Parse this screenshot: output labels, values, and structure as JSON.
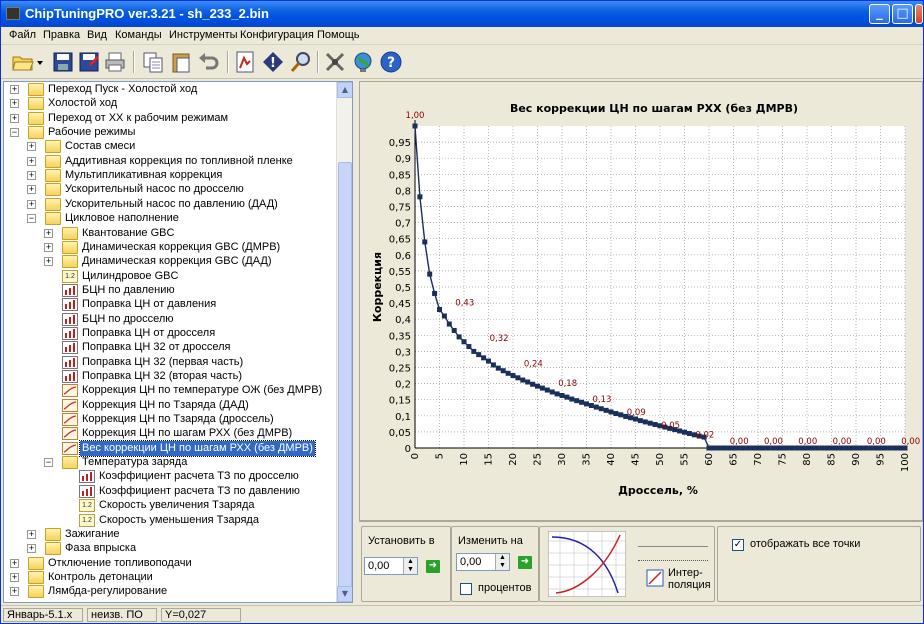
{
  "window": {
    "title": "ChipTuningPRO ver.3.21 - sh_233_2.bin"
  },
  "menu": [
    "Файл",
    "Правка",
    "Вид",
    "Команды",
    "Инструменты",
    "Конфигурация",
    "Помощь"
  ],
  "toolbar": {
    "icons": [
      "open-icon",
      "dropdown-arrow-icon",
      "save-icon",
      "save-as-icon",
      "print-icon",
      "copy-icon",
      "paste-icon",
      "undo-icon",
      "open-map-icon",
      "info-icon",
      "search-icon",
      "tools-icon",
      "globe-icon",
      "help-icon"
    ]
  },
  "tree": {
    "items": [
      {
        "label": "Переход Пуск - Холостой ход",
        "exp": "+",
        "icon": "folder",
        "depth": 0
      },
      {
        "label": "Холостой ход",
        "exp": "+",
        "icon": "folder",
        "depth": 0
      },
      {
        "label": "Переход от ХХ к рабочим режимам",
        "exp": "+",
        "icon": "folder",
        "depth": 0
      },
      {
        "label": "Рабочие режимы",
        "exp": "-",
        "icon": "folder",
        "depth": 0
      },
      {
        "label": "Состав смеси",
        "exp": "+",
        "icon": "folder",
        "depth": 1
      },
      {
        "label": "Аддитивная коррекция по топливной пленке",
        "exp": "+",
        "icon": "folder",
        "depth": 1
      },
      {
        "label": "Мультипликативная коррекция",
        "exp": "+",
        "icon": "folder",
        "depth": 1
      },
      {
        "label": "Ускорительный насос по дросселю",
        "exp": "+",
        "icon": "folder",
        "depth": 1
      },
      {
        "label": "Ускорительный насос по давлению (ДАД)",
        "exp": "+",
        "icon": "folder",
        "depth": 1
      },
      {
        "label": "Цикловое наполнение",
        "exp": "-",
        "icon": "folder",
        "depth": 1
      },
      {
        "label": "Квантование GBC",
        "exp": "+",
        "icon": "folder",
        "depth": 2
      },
      {
        "label": "Динамическая коррекция GBC (ДМРВ)",
        "exp": "+",
        "icon": "folder",
        "depth": 2
      },
      {
        "label": "Динамическая коррекция GBC (ДАД)",
        "exp": "+",
        "icon": "folder",
        "depth": 2
      },
      {
        "label": "Цилиндровое GBC",
        "exp": "",
        "icon": "12",
        "depth": 2
      },
      {
        "label": "БЦН по давлению",
        "exp": "",
        "icon": "bar",
        "depth": 2
      },
      {
        "label": "Поправка ЦН от давления",
        "exp": "",
        "icon": "bar",
        "depth": 2
      },
      {
        "label": "БЦН по дросселю",
        "exp": "",
        "icon": "bar",
        "depth": 2
      },
      {
        "label": "Поправка ЦН от дросселя",
        "exp": "",
        "icon": "bar",
        "depth": 2
      },
      {
        "label": "Поправка ЦН 32 от дросселя",
        "exp": "",
        "icon": "bar",
        "depth": 2
      },
      {
        "label": "Поправка ЦН 32 (первая часть)",
        "exp": "",
        "icon": "bar",
        "depth": 2
      },
      {
        "label": "Поправка ЦН 32 (вторая часть)",
        "exp": "",
        "icon": "bar",
        "depth": 2
      },
      {
        "label": "Коррекция ЦН по температуре ОЖ (без ДМРВ)",
        "exp": "",
        "icon": "chart",
        "depth": 2
      },
      {
        "label": "Коррекция ЦН по Тзаряда (ДАД)",
        "exp": "",
        "icon": "chart",
        "depth": 2
      },
      {
        "label": "Коррекция ЦН по Тзаряда (дроссель)",
        "exp": "",
        "icon": "chart",
        "depth": 2
      },
      {
        "label": "Коррекция ЦН по шагам РХХ (без ДМРВ)",
        "exp": "",
        "icon": "chart",
        "depth": 2
      },
      {
        "label": "Вес коррекции ЦН по шагам РХХ (без ДМРВ)",
        "exp": "",
        "icon": "chart",
        "depth": 2,
        "selected": true
      },
      {
        "label": "Температура заряда",
        "exp": "-",
        "icon": "folder",
        "depth": 2
      },
      {
        "label": "Коэффициент расчета ТЗ по дросселю",
        "exp": "",
        "icon": "bar",
        "depth": 3
      },
      {
        "label": "Коэффициент расчета ТЗ по давлению",
        "exp": "",
        "icon": "bar",
        "depth": 3
      },
      {
        "label": "Скорость увеличения Тзаряда",
        "exp": "",
        "icon": "12",
        "depth": 3
      },
      {
        "label": "Скорость уменьшения Тзаряда",
        "exp": "",
        "icon": "12",
        "depth": 3
      },
      {
        "label": "Зажигание",
        "exp": "+",
        "icon": "folder",
        "depth": 1
      },
      {
        "label": "Фаза впрыска",
        "exp": "+",
        "icon": "folder",
        "depth": 1
      },
      {
        "label": "Отключение топливоподачи",
        "exp": "+",
        "icon": "folder",
        "depth": 0
      },
      {
        "label": "Контроль детонации",
        "exp": "+",
        "icon": "folder",
        "depth": 0
      },
      {
        "label": "Лямбда-регулирование",
        "exp": "+",
        "icon": "folder",
        "depth": 0
      }
    ]
  },
  "chart_data": {
    "type": "line",
    "title": "Вес коррекции ЦН по шагам РХХ (без ДМРВ)",
    "xlabel": "Дроссель, %",
    "ylabel": "Коррекция",
    "xlim": [
      0,
      100
    ],
    "ylim": [
      0,
      1
    ],
    "xticks": [
      "0",
      "5",
      "10",
      "15",
      "20",
      "25",
      "30",
      "35",
      "40",
      "45",
      "50",
      "55",
      "60",
      "65",
      "70",
      "75",
      "80",
      "85",
      "90",
      "95",
      "100"
    ],
    "yticks": [
      "0",
      "0,05",
      "0,1",
      "0,15",
      "0,2",
      "0,25",
      "0,3",
      "0,35",
      "0,4",
      "0,45",
      "0,5",
      "0,55",
      "0,6",
      "0,65",
      "0,7",
      "0,75",
      "0,8",
      "0,85",
      "0,9",
      "0,95"
    ],
    "x": [
      0,
      1,
      2,
      3,
      4,
      5,
      6,
      7,
      8,
      9,
      10,
      11,
      12,
      13,
      14,
      15,
      16,
      17,
      18,
      19,
      20,
      21,
      22,
      23,
      24,
      25,
      26,
      27,
      28,
      29,
      30,
      31,
      32,
      33,
      34,
      35,
      36,
      37,
      38,
      39,
      40,
      41,
      42,
      43,
      44,
      45,
      46,
      47,
      48,
      49,
      50,
      51,
      52,
      53,
      54,
      55,
      56,
      57,
      58,
      59,
      60,
      61,
      62,
      63,
      64,
      65,
      66,
      67,
      68,
      69,
      70,
      71,
      72,
      73,
      74,
      75,
      76,
      77,
      78,
      79,
      80,
      81,
      82,
      83,
      84,
      85,
      86,
      87,
      88,
      89,
      90,
      91,
      92,
      93,
      94,
      95,
      96,
      97,
      98,
      99,
      100
    ],
    "y": [
      1.0,
      0.78,
      0.64,
      0.54,
      0.48,
      0.43,
      0.41,
      0.385,
      0.365,
      0.345,
      0.33,
      0.315,
      0.3,
      0.29,
      0.28,
      0.27,
      0.258,
      0.248,
      0.24,
      0.232,
      0.225,
      0.218,
      0.211,
      0.205,
      0.198,
      0.192,
      0.186,
      0.18,
      0.174,
      0.168,
      0.163,
      0.158,
      0.152,
      0.147,
      0.142,
      0.137,
      0.132,
      0.127,
      0.122,
      0.117,
      0.112,
      0.107,
      0.103,
      0.098,
      0.094,
      0.09,
      0.085,
      0.081,
      0.077,
      0.073,
      0.069,
      0.065,
      0.061,
      0.057,
      0.053,
      0.049,
      0.045,
      0.041,
      0.037,
      0.034,
      0.0,
      0.0,
      0.0,
      0.0,
      0.0,
      0.0,
      0.0,
      0.0,
      0.0,
      0.0,
      0.0,
      0.0,
      0.0,
      0.0,
      0.0,
      0.0,
      0.0,
      0.0,
      0.0,
      0.0,
      0.0,
      0.0,
      0.0,
      0.0,
      0.0,
      0.0,
      0.0,
      0.0,
      0.0,
      0.0,
      0.0,
      0.0,
      0.0,
      0.0,
      0.0,
      0.0,
      0.0,
      0.0,
      0.0,
      0.0,
      0.0
    ],
    "labels": [
      {
        "x": 0,
        "y": 1.0,
        "text": "1,00"
      },
      {
        "x": 7,
        "y": 0.43,
        "text": "0,43"
      },
      {
        "x": 14,
        "y": 0.32,
        "text": "0,32"
      },
      {
        "x": 21,
        "y": 0.24,
        "text": "0,24"
      },
      {
        "x": 28,
        "y": 0.18,
        "text": "0,18"
      },
      {
        "x": 35,
        "y": 0.13,
        "text": "0,13"
      },
      {
        "x": 42,
        "y": 0.09,
        "text": "0,09"
      },
      {
        "x": 49,
        "y": 0.05,
        "text": "0,05"
      },
      {
        "x": 56,
        "y": 0.02,
        "text": "0,02"
      },
      {
        "x": 63,
        "y": 0.0,
        "text": "0,00"
      },
      {
        "x": 70,
        "y": 0.0,
        "text": "0,00"
      },
      {
        "x": 77,
        "y": 0.0,
        "text": "0,00"
      },
      {
        "x": 84,
        "y": 0.0,
        "text": "0,00"
      },
      {
        "x": 91,
        "y": 0.0,
        "text": "0,00"
      },
      {
        "x": 98,
        "y": 0.0,
        "text": "0,00"
      }
    ],
    "grid": true,
    "line_color": "#1a2f5a",
    "label_color": "#8b0000"
  },
  "controls": {
    "set_label": "Установить в",
    "set_value": "0,00",
    "change_label": "Изменить на",
    "change_value": "0,00",
    "percent_label": "процентов",
    "interp_label1": "Интер-",
    "interp_label2": "поляция",
    "show_all_label": "отображать все точки"
  },
  "status": {
    "cell1": "Январь-5.1.x",
    "cell2": "неизв. ПО",
    "cell3": "Y=0,027"
  }
}
